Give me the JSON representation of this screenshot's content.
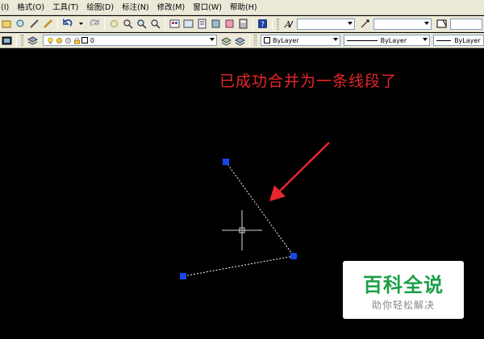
{
  "menu": {
    "items": [
      "(I)",
      "格式(O)",
      "工具(T)",
      "绘图(D)",
      "标注(N)",
      "修改(M)",
      "窗口(W)",
      "帮助(H)"
    ]
  },
  "toolbar_layers": {
    "layer_name": "0"
  },
  "properties": {
    "color": "ByLayer",
    "linetype": "ByLayer",
    "lineweight": "ByLayer"
  },
  "drawing": {
    "annotation": "已成功合并为一条线段了",
    "annotation_color": "#e8262a",
    "grip_color": "#1a46e6",
    "line_color": "#ffffff"
  },
  "watermark": {
    "main": "百科全说",
    "sub": "助你轻松解决",
    "color": "#1aa046"
  }
}
